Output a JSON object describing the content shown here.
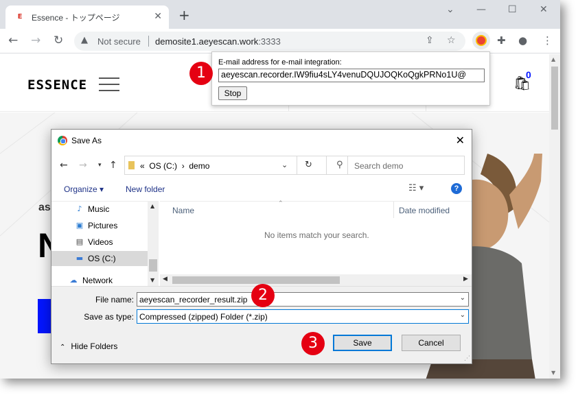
{
  "browser": {
    "tab_favicon": "E",
    "tab_title": "Essence - トップページ",
    "tab_close": "✕",
    "new_tab": "+",
    "window_controls": [
      "⌄",
      "—",
      "☐",
      "✕"
    ],
    "not_secure": "Not secure",
    "host": "demosite1.aeyescan.work",
    "port": ":3333"
  },
  "site": {
    "logo": "ESSENCE",
    "cart_count": "0",
    "hero_sub": "as",
    "hero_big": "N"
  },
  "popup": {
    "label": "E-mail address for e-mail integration:",
    "email_value": "aeyescan.recorder.IW9fiu4sLY4venuDQUJOQKoQgkPRNo1U@",
    "stop_label": "Stop"
  },
  "callouts": [
    "1",
    "2",
    "3"
  ],
  "dialog": {
    "title": "Save As",
    "path_prefix": "«",
    "path_drive": "OS (C:)",
    "path_sep": "›",
    "path_folder": "demo",
    "search_placeholder": "Search demo",
    "organize": "Organize ▾",
    "new_folder": "New folder",
    "help": "?",
    "nav_items": [
      {
        "label": "Music",
        "icon": "music-icon"
      },
      {
        "label": "Pictures",
        "icon": "pictures-icon"
      },
      {
        "label": "Videos",
        "icon": "videos-icon"
      },
      {
        "label": "OS (C:)",
        "icon": "drive-icon"
      },
      {
        "label": "Network",
        "icon": "network-icon"
      }
    ],
    "col_name": "Name",
    "col_date": "Date modified",
    "empty_message": "No items match your search.",
    "file_name_label": "File name:",
    "file_name_value": "aeyescan_recorder_result.zip",
    "save_type_label": "Save as type:",
    "save_type_value": "Compressed (zipped) Folder (*.zip)",
    "hide_folders": "Hide Folders",
    "save_label": "Save",
    "cancel_label": "Cancel"
  },
  "colors": {
    "callout": "#e50012",
    "accent_blue": "#0315ff",
    "dialog_focus": "#0078d7"
  }
}
